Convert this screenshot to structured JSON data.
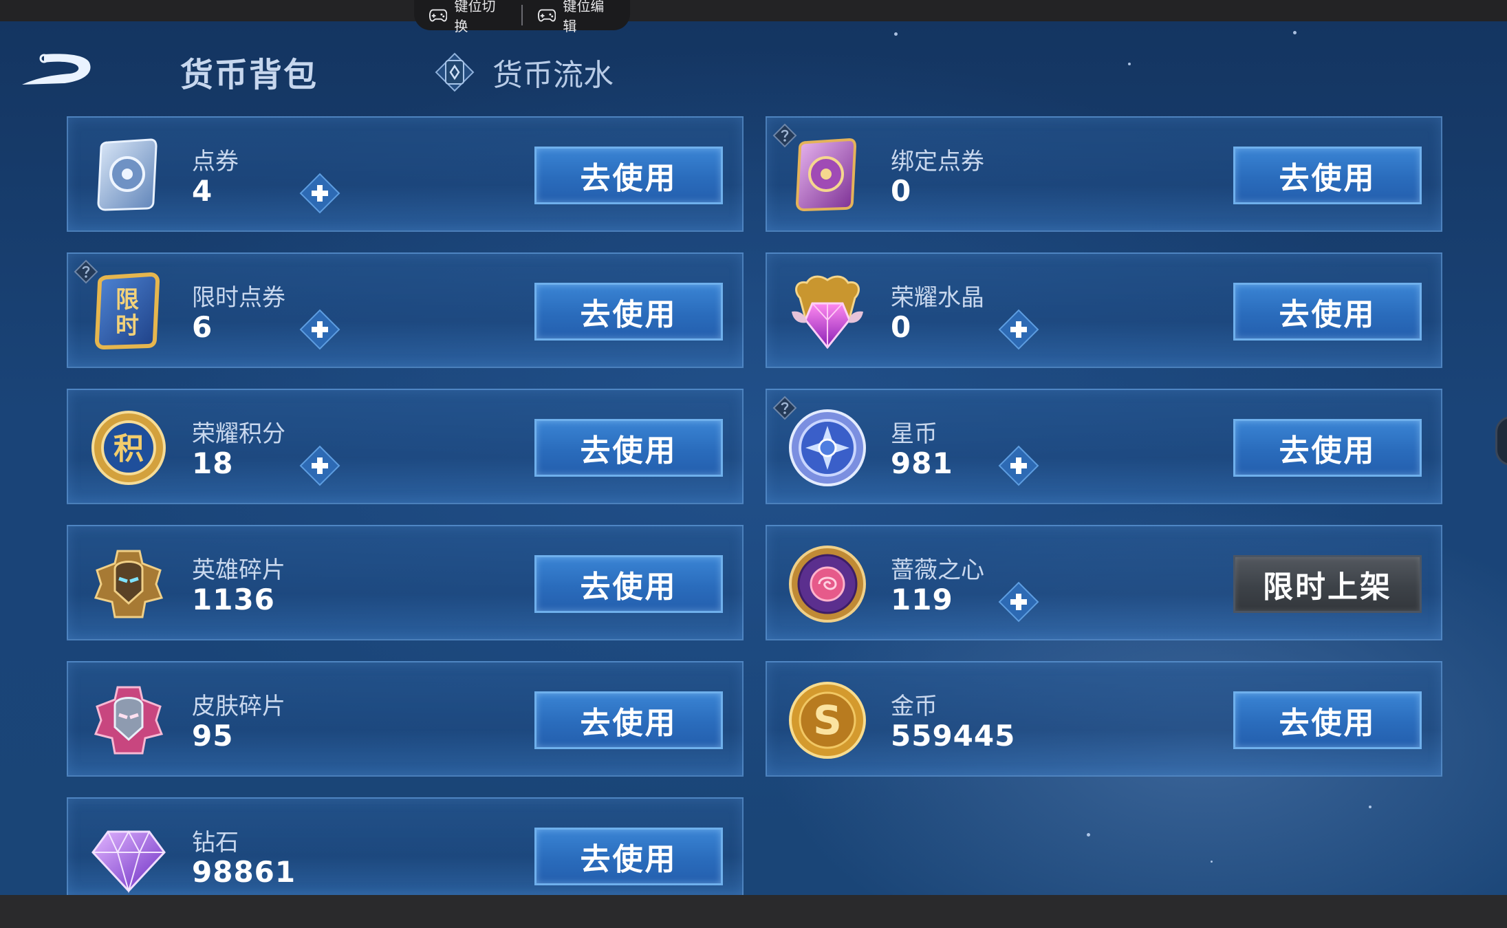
{
  "emulator": {
    "key_switch_label": "键位切换",
    "key_edit_label": "键位编辑"
  },
  "header": {
    "title": "货币背包",
    "flow_tab": "货币流水"
  },
  "currencies": [
    {
      "name": "点券",
      "amount": "4",
      "button": "去使用"
    },
    {
      "name": "绑定点券",
      "amount": "0",
      "button": "去使用"
    },
    {
      "name": "限时点券",
      "amount": "6",
      "button": "去使用"
    },
    {
      "name": "荣耀水晶",
      "amount": "0",
      "button": "去使用"
    },
    {
      "name": "荣耀积分",
      "amount": "18",
      "button": "去使用"
    },
    {
      "name": "星币",
      "amount": "981",
      "button": "去使用"
    },
    {
      "name": "英雄碎片",
      "amount": "1136",
      "button": "去使用"
    },
    {
      "name": "蔷薇之心",
      "amount": "119",
      "button": "限时上架"
    },
    {
      "name": "皮肤碎片",
      "amount": "95",
      "button": "去使用"
    },
    {
      "name": "金币",
      "amount": "559445",
      "button": "去使用"
    },
    {
      "name": "钻石",
      "amount": "98861",
      "button": "去使用"
    }
  ],
  "icon_text": {
    "limited_coupon_glyph": "限时",
    "points_glyph": "积",
    "gold_glyph": "S"
  }
}
